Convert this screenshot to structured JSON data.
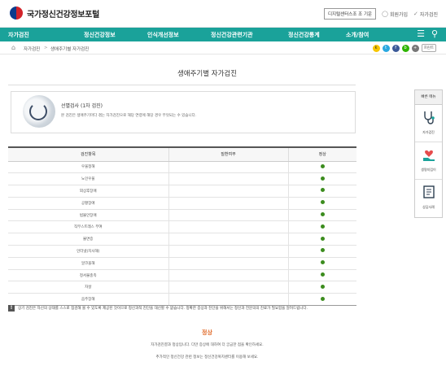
{
  "header": {
    "site_title": "국가정신건강정보포털",
    "top_button": "디지털센터스조 조 기운",
    "top_link_1": "회원가입",
    "top_link_2": "자가검진"
  },
  "nav": {
    "items": [
      "자가검진",
      "정신건강정보",
      "인식개선정보",
      "정신건강관련기관",
      "정신건강통계",
      "소개/참여"
    ]
  },
  "breadcrumb": {
    "items": [
      "자가검진",
      "생애주기별 자가검진"
    ]
  },
  "share": {
    "print_label": "프린트",
    "sns": [
      "k",
      "t",
      "f",
      "b"
    ]
  },
  "page": {
    "title": "생애주기별 자가검진",
    "intro_title": "선별검사 (1차 검진)",
    "intro_text": "본 검진은 생애주기마다 겪는 자가검진으로 해당 연령에 해당 경우 무엇되는 수 있습니다."
  },
  "table": {
    "headers": [
      "검진항목",
      "질환여부",
      "정상"
    ],
    "rows": [
      {
        "item": "우울정해",
        "result": ""
      },
      {
        "item": "노인우울",
        "result": ""
      },
      {
        "item": "외상후장애",
        "result": ""
      },
      {
        "item": "공황장애",
        "result": ""
      },
      {
        "item": "범불안장애",
        "result": ""
      },
      {
        "item": "직무스트레스 부여",
        "result": ""
      },
      {
        "item": "불면증",
        "result": ""
      },
      {
        "item": "인터넷(치사해)",
        "result": ""
      },
      {
        "item": "알코올해",
        "result": ""
      },
      {
        "item": "정서불충족",
        "result": ""
      },
      {
        "item": "자살",
        "result": ""
      },
      {
        "item": "음주장해",
        "result": ""
      }
    ]
  },
  "notice": {
    "text": "상기 검진은 자신의 상태를 스스로 점검해 볼 수 있도록 제공된 것이므로 정신과적 진단을 대신할 수 없습니다. 정확한 증상과 진단을 위해서는 정신과 전문의의 진료가 필요함을 알려드립니다."
  },
  "bottom": {
    "status": "정상",
    "line1": "자가검진결과 정상입니다. 다만 증상에 대하여 더 궁금한 점을 확인하세요.",
    "line2": "추가적인 정신건강 관련 정보는 정신건강복지센터를 이용해 보세요."
  },
  "quick_menu": {
    "title": "빠른 메뉴",
    "items": [
      "자가검진",
      "생명지킴이",
      "상담사례"
    ]
  },
  "colors": {
    "nav_bg": "#1aa29a",
    "status_dot": "#3c8c1e",
    "status_title": "#e06b2b"
  },
  "icons": [
    "home-icon",
    "menu-icon",
    "search-icon",
    "stethoscope-icon",
    "heart-hand-icon",
    "book-icon",
    "info-icon"
  ]
}
